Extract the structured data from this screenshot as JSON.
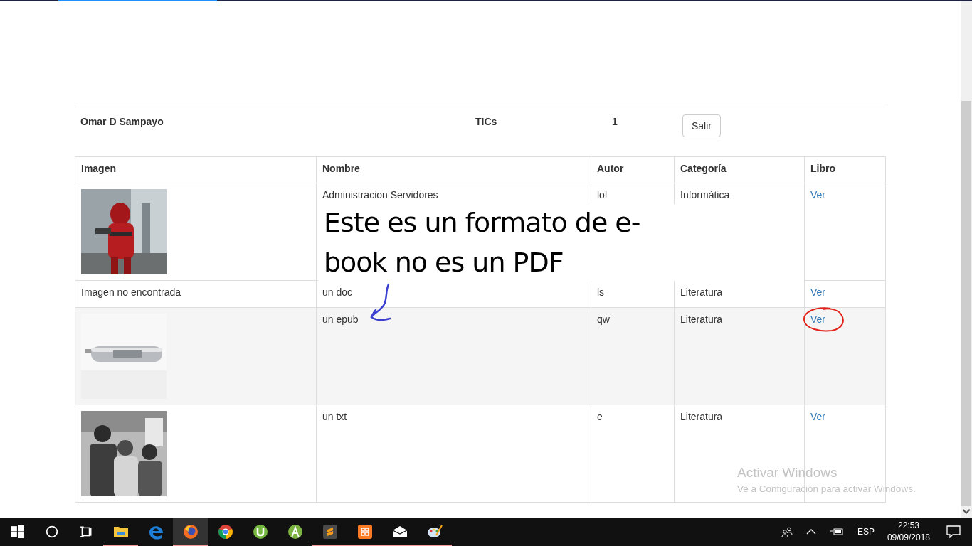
{
  "user": {
    "name": "Omar D Sampayo",
    "area": "TICs",
    "count": "1",
    "logout": "Salir"
  },
  "table": {
    "columns": [
      "Imagen",
      "Nombre",
      "Autor",
      "Categoría",
      "Libro"
    ],
    "rows": [
      {
        "name": "Administracion Servidores",
        "author": "lol",
        "category": "Informática",
        "link": "Ver",
        "hovered": false,
        "circled": false
      },
      {
        "image": {
          "kind": "missing",
          "text": "Imagen no encontrada"
        },
        "name": "un doc",
        "author": "ls",
        "category": "Literatura",
        "link": "Ver",
        "hovered": false,
        "circled": false
      },
      {
        "name": "un epub",
        "author": "qw",
        "category": "Literatura",
        "link": "Ver",
        "hovered": true,
        "circled": true
      },
      {
        "name": "un txt",
        "author": "e",
        "category": "Literatura",
        "link": "Ver",
        "hovered": false,
        "circled": false
      }
    ]
  },
  "annotation": {
    "text": "Este es un formato de e-book no es un PDF"
  },
  "activation_notice": {
    "title": "Activar Windows",
    "message": "Ve a Configuración para activar Windows."
  },
  "taskbar": {
    "apps": [
      {
        "kind": "folder",
        "running": true,
        "selected": false
      },
      {
        "kind": "edge",
        "running": false,
        "selected": false
      },
      {
        "kind": "firefox",
        "running": true,
        "selected": true
      },
      {
        "kind": "chrome",
        "running": false,
        "selected": false
      },
      {
        "kind": "torrent",
        "running": false,
        "selected": false
      },
      {
        "kind": "android",
        "running": false,
        "selected": false
      },
      {
        "kind": "sublime",
        "running": true,
        "selected": false
      },
      {
        "kind": "xampp",
        "running": true,
        "selected": false
      },
      {
        "kind": "mail",
        "running": true,
        "selected": false
      },
      {
        "kind": "paint",
        "running": true,
        "selected": false
      }
    ],
    "language": "ESP",
    "time": "22:53",
    "date": "09/09/2018"
  }
}
